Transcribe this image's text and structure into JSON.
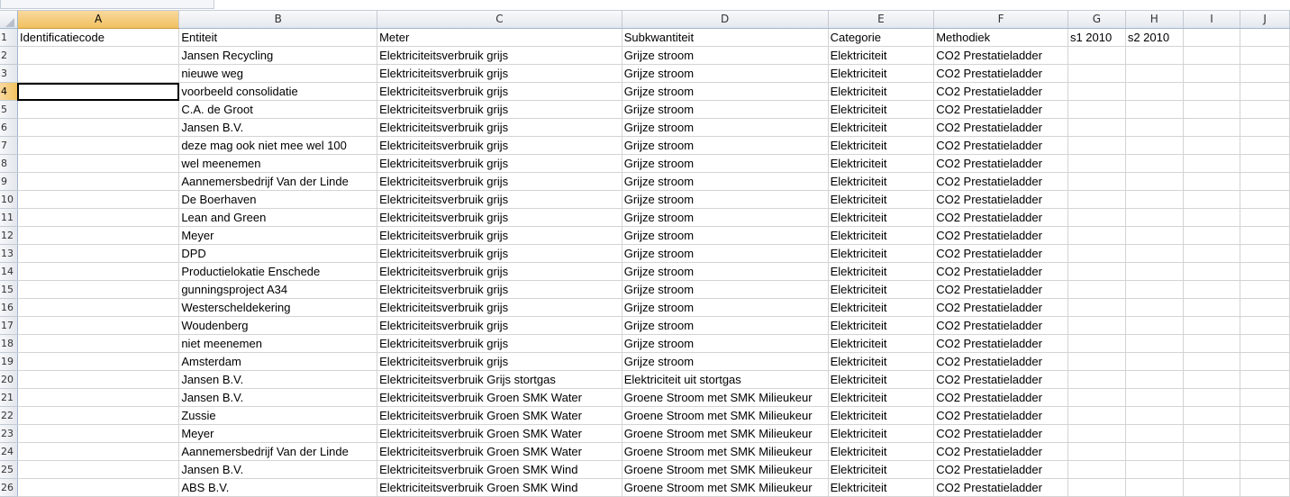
{
  "columns": [
    "A",
    "B",
    "C",
    "D",
    "E",
    "F",
    "G",
    "H",
    "I",
    "J"
  ],
  "selected_column": "A",
  "selected_row": "4",
  "rows": [
    {
      "num": "1",
      "cells": [
        "Identificatiecode",
        "Entiteit",
        "Meter",
        "Subkwantiteit",
        "Categorie",
        "Methodiek",
        "s1 2010",
        "s2 2010",
        "",
        ""
      ]
    },
    {
      "num": "2",
      "cells": [
        "",
        "Jansen Recycling",
        "Elektriciteitsverbruik grijs",
        "Grijze stroom",
        "Elektriciteit",
        "CO2 Prestatieladder",
        "",
        "",
        "",
        ""
      ]
    },
    {
      "num": "3",
      "cells": [
        "",
        "nieuwe weg",
        "Elektriciteitsverbruik grijs",
        "Grijze stroom",
        "Elektriciteit",
        "CO2 Prestatieladder",
        "",
        "",
        "",
        ""
      ]
    },
    {
      "num": "4",
      "cells": [
        "",
        "voorbeeld consolidatie",
        "Elektriciteitsverbruik grijs",
        "Grijze stroom",
        "Elektriciteit",
        "CO2 Prestatieladder",
        "",
        "",
        "",
        ""
      ]
    },
    {
      "num": "5",
      "cells": [
        "",
        "C.A. de Groot",
        "Elektriciteitsverbruik grijs",
        "Grijze stroom",
        "Elektriciteit",
        "CO2 Prestatieladder",
        "",
        "",
        "",
        ""
      ]
    },
    {
      "num": "6",
      "cells": [
        "",
        "Jansen B.V.",
        "Elektriciteitsverbruik grijs",
        "Grijze stroom",
        "Elektriciteit",
        "CO2 Prestatieladder",
        "",
        "",
        "",
        ""
      ]
    },
    {
      "num": "7",
      "cells": [
        "",
        "deze mag ook niet mee wel 100",
        "Elektriciteitsverbruik grijs",
        "Grijze stroom",
        "Elektriciteit",
        "CO2 Prestatieladder",
        "",
        "",
        "",
        ""
      ]
    },
    {
      "num": "8",
      "cells": [
        "",
        "wel meenemen",
        "Elektriciteitsverbruik grijs",
        "Grijze stroom",
        "Elektriciteit",
        "CO2 Prestatieladder",
        "",
        "",
        "",
        ""
      ]
    },
    {
      "num": "9",
      "cells": [
        "",
        "Aannemersbedrijf Van der Linde",
        "Elektriciteitsverbruik grijs",
        "Grijze stroom",
        "Elektriciteit",
        "CO2 Prestatieladder",
        "",
        "",
        "",
        ""
      ]
    },
    {
      "num": "10",
      "cells": [
        "",
        "De Boerhaven",
        "Elektriciteitsverbruik grijs",
        "Grijze stroom",
        "Elektriciteit",
        "CO2 Prestatieladder",
        "",
        "",
        "",
        ""
      ]
    },
    {
      "num": "11",
      "cells": [
        "",
        "Lean and Green",
        "Elektriciteitsverbruik grijs",
        "Grijze stroom",
        "Elektriciteit",
        "CO2 Prestatieladder",
        "",
        "",
        "",
        ""
      ]
    },
    {
      "num": "12",
      "cells": [
        "",
        "Meyer",
        "Elektriciteitsverbruik grijs",
        "Grijze stroom",
        "Elektriciteit",
        "CO2 Prestatieladder",
        "",
        "",
        "",
        ""
      ]
    },
    {
      "num": "13",
      "cells": [
        "",
        "DPD",
        "Elektriciteitsverbruik grijs",
        "Grijze stroom",
        "Elektriciteit",
        "CO2 Prestatieladder",
        "",
        "",
        "",
        ""
      ]
    },
    {
      "num": "14",
      "cells": [
        "",
        "Productielokatie Enschede",
        "Elektriciteitsverbruik grijs",
        "Grijze stroom",
        "Elektriciteit",
        "CO2 Prestatieladder",
        "",
        "",
        "",
        ""
      ]
    },
    {
      "num": "15",
      "cells": [
        "",
        "gunningsproject A34",
        "Elektriciteitsverbruik grijs",
        "Grijze stroom",
        "Elektriciteit",
        "CO2 Prestatieladder",
        "",
        "",
        "",
        ""
      ]
    },
    {
      "num": "16",
      "cells": [
        "",
        "Westerscheldekering",
        "Elektriciteitsverbruik grijs",
        "Grijze stroom",
        "Elektriciteit",
        "CO2 Prestatieladder",
        "",
        "",
        "",
        ""
      ]
    },
    {
      "num": "17",
      "cells": [
        "",
        "Woudenberg",
        "Elektriciteitsverbruik grijs",
        "Grijze stroom",
        "Elektriciteit",
        "CO2 Prestatieladder",
        "",
        "",
        "",
        ""
      ]
    },
    {
      "num": "18",
      "cells": [
        "",
        "niet meenemen",
        "Elektriciteitsverbruik grijs",
        "Grijze stroom",
        "Elektriciteit",
        "CO2 Prestatieladder",
        "",
        "",
        "",
        ""
      ]
    },
    {
      "num": "19",
      "cells": [
        "",
        "Amsterdam",
        "Elektriciteitsverbruik grijs",
        "Grijze stroom",
        "Elektriciteit",
        "CO2 Prestatieladder",
        "",
        "",
        "",
        ""
      ]
    },
    {
      "num": "20",
      "cells": [
        "",
        "Jansen B.V.",
        "Elektriciteitsverbruik Grijs stortgas",
        "Elektriciteit uit stortgas",
        "Elektriciteit",
        "CO2 Prestatieladder",
        "",
        "",
        "",
        ""
      ]
    },
    {
      "num": "21",
      "cells": [
        "",
        "Jansen B.V.",
        "Elektriciteitsverbruik Groen SMK Water",
        "Groene Stroom met SMK Milieukeur",
        "Elektriciteit",
        "CO2 Prestatieladder",
        "",
        "",
        "",
        ""
      ]
    },
    {
      "num": "22",
      "cells": [
        "",
        "Zussie",
        "Elektriciteitsverbruik Groen SMK Water",
        "Groene Stroom met SMK Milieukeur",
        "Elektriciteit",
        "CO2 Prestatieladder",
        "",
        "",
        "",
        ""
      ]
    },
    {
      "num": "23",
      "cells": [
        "",
        "Meyer",
        "Elektriciteitsverbruik Groen SMK Water",
        "Groene Stroom met SMK Milieukeur",
        "Elektriciteit",
        "CO2 Prestatieladder",
        "",
        "",
        "",
        ""
      ]
    },
    {
      "num": "24",
      "cells": [
        "",
        "Aannemersbedrijf Van der Linde",
        "Elektriciteitsverbruik Groen SMK Water",
        "Groene Stroom met SMK Milieukeur",
        "Elektriciteit",
        "CO2 Prestatieladder",
        "",
        "",
        "",
        ""
      ]
    },
    {
      "num": "25",
      "cells": [
        "",
        "Jansen B.V.",
        "Elektriciteitsverbruik Groen SMK Wind",
        "Groene Stroom met SMK Milieukeur",
        "Elektriciteit",
        "CO2 Prestatieladder",
        "",
        "",
        "",
        ""
      ]
    },
    {
      "num": "26",
      "cells": [
        "",
        "ABS B.V.",
        "Elektriciteitsverbruik Groen SMK Wind",
        "Groene Stroom met SMK Milieukeur",
        "Elektriciteit",
        "CO2 Prestatieladder",
        "",
        "",
        "",
        ""
      ]
    }
  ]
}
